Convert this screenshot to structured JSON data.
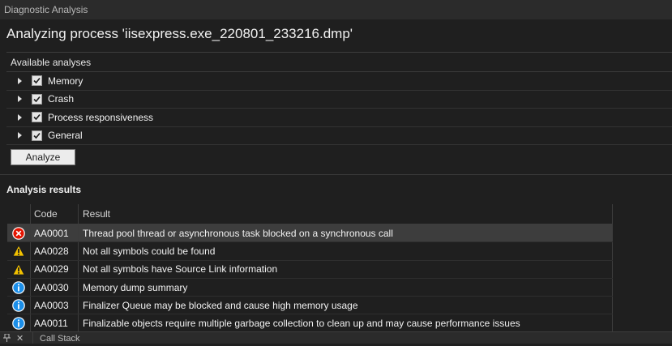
{
  "window": {
    "title": "Diagnostic Analysis"
  },
  "header": {
    "title": "Analyzing process 'iisexpress.exe_220801_233216.dmp'"
  },
  "analyses": {
    "header": "Available analyses",
    "items": [
      {
        "label": "Memory",
        "checked": true
      },
      {
        "label": "Crash",
        "checked": true
      },
      {
        "label": "Process responsiveness",
        "checked": true
      },
      {
        "label": "General",
        "checked": true
      }
    ],
    "analyze_button": "Analyze"
  },
  "results": {
    "title": "Analysis results",
    "columns": {
      "icon": "",
      "code": "Code",
      "result": "Result"
    },
    "rows": [
      {
        "icon": "error-icon",
        "code": "AA0001",
        "result": "Thread pool thread or asynchronous task blocked on a synchronous call"
      },
      {
        "icon": "warning-icon",
        "code": "AA0028",
        "result": "Not all symbols could be found"
      },
      {
        "icon": "warning-icon",
        "code": "AA0029",
        "result": "Not all symbols have Source Link information"
      },
      {
        "icon": "info-icon",
        "code": "AA0030",
        "result": "Memory dump summary"
      },
      {
        "icon": "info-icon",
        "code": "AA0003",
        "result": "Finalizer Queue may be blocked and cause high memory usage"
      },
      {
        "icon": "info-icon",
        "code": "AA0011",
        "result": "Finalizable objects require multiple garbage collection to clean up and may cause performance issues"
      }
    ]
  },
  "bottom_tabs": {
    "call_stack": "Call Stack"
  },
  "colors": {
    "error": "#e51400",
    "warning": "#f2c100",
    "info": "#1b8ee8"
  }
}
